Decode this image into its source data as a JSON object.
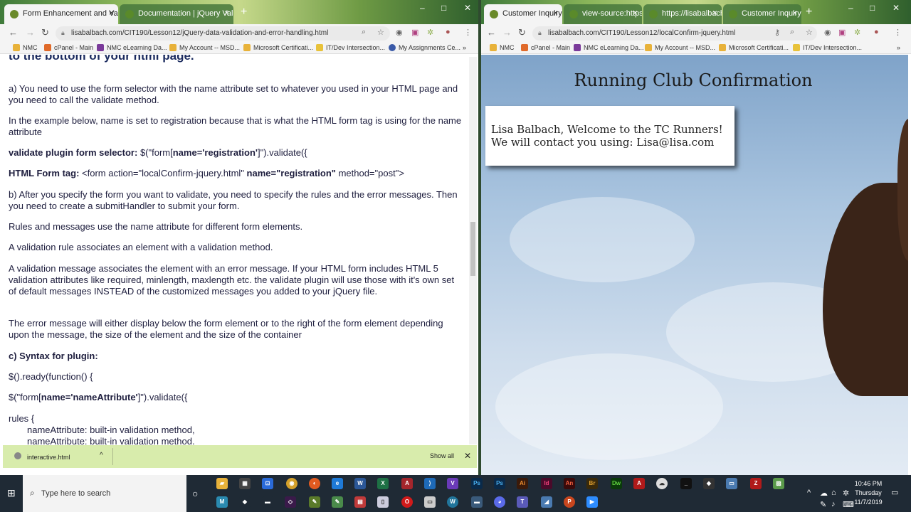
{
  "left_window": {
    "tabs": [
      {
        "label": "Form Enhancement and Validati"
      },
      {
        "label": "Documentation | jQuery Validat"
      }
    ],
    "url": "lisabalbach.com/CIT190/Lesson12/jQuery-data-validation-and-error-handling.html",
    "bookmarks": [
      "NMC",
      "cPanel - Main",
      "NMC eLearning Da...",
      "My Account -- MSD...",
      "Microsoft Certificati...",
      "IT/Dev Intersection...",
      "My Assignments Ce..."
    ],
    "doc": {
      "heading": "to the bottom of your html page.",
      "p_a": "a) You need to use the form selector with the name attribute set to whatever you used in your HTML page and you need to call the validate method.",
      "p_example": "In the example below, name is set to registration because that is what the HTML form tag is using for the name attribute",
      "selector_label": "validate plugin form selector:",
      "selector_pre": " $(\"form[",
      "selector_bold": "name='registration'",
      "selector_post": "]\").validate({",
      "form_tag_label": "HTML Form tag:",
      "form_tag_pre": " <form action=\"localConfirm-jquery.html\" ",
      "form_tag_bold": "name=\"registration\"",
      "form_tag_post": " method=\"post\">",
      "p_b": "b) After you specify the form you want to validate, you need to specify the rules and the error messages. Then you need to create a submitHandler to submit your form.",
      "p_rules": "Rules and messages use the name attribute for different form elements.",
      "p_rule_def": "A validation rule associates an element with a validation method.",
      "p_msg_def": "A validation message associates the element with an error message.  If your HTML form includes HTML 5 validation attributes like required, minlength, maxlength etc. the validate plugin will use those with it's own set of default messages INSTEAD of the customized messages you added to your jQuery file.",
      "p_display": "The error message will either display below the form element or to the right of the form element depending upon the message, the size of the element and the size of the container",
      "p_c": "c) Syntax for plugin:",
      "code_ready": "$().ready(function() {",
      "code_validate_pre": "$(\"form[",
      "code_validate_bold": "name='nameAttribute'",
      "code_validate_post": "]\").validate({",
      "code_rules": "rules {",
      "code_line1": "nameAttribute: built-in validation method,",
      "code_line2": "nameAttribute: built-in validation method,"
    },
    "download_file": "interactive.html",
    "show_all": "Show all"
  },
  "right_window": {
    "tabs": [
      {
        "label": "Customer Inquiry"
      },
      {
        "label": "view-source:https:"
      },
      {
        "label": "https://lisabalbach"
      },
      {
        "label": "Customer Inquiry"
      }
    ],
    "url": "lisabalbach.com/CIT190/Lesson12/localConfirm-jquery.html",
    "bookmarks": [
      "NMC",
      "cPanel - Main",
      "NMC eLearning Da...",
      "My Account -- MSD...",
      "Microsoft Certificati...",
      "IT/Dev Intersection..."
    ],
    "page_title": "Running Club Confirmation",
    "welcome": "Lisa Balbach, Welcome to the TC Runners!",
    "contact": "We will contact you using: Lisa@lisa.com"
  },
  "taskbar": {
    "search_placeholder": "Type here to search",
    "time": "10:46 PM",
    "day": "Thursday",
    "date": "11/7/2019"
  }
}
